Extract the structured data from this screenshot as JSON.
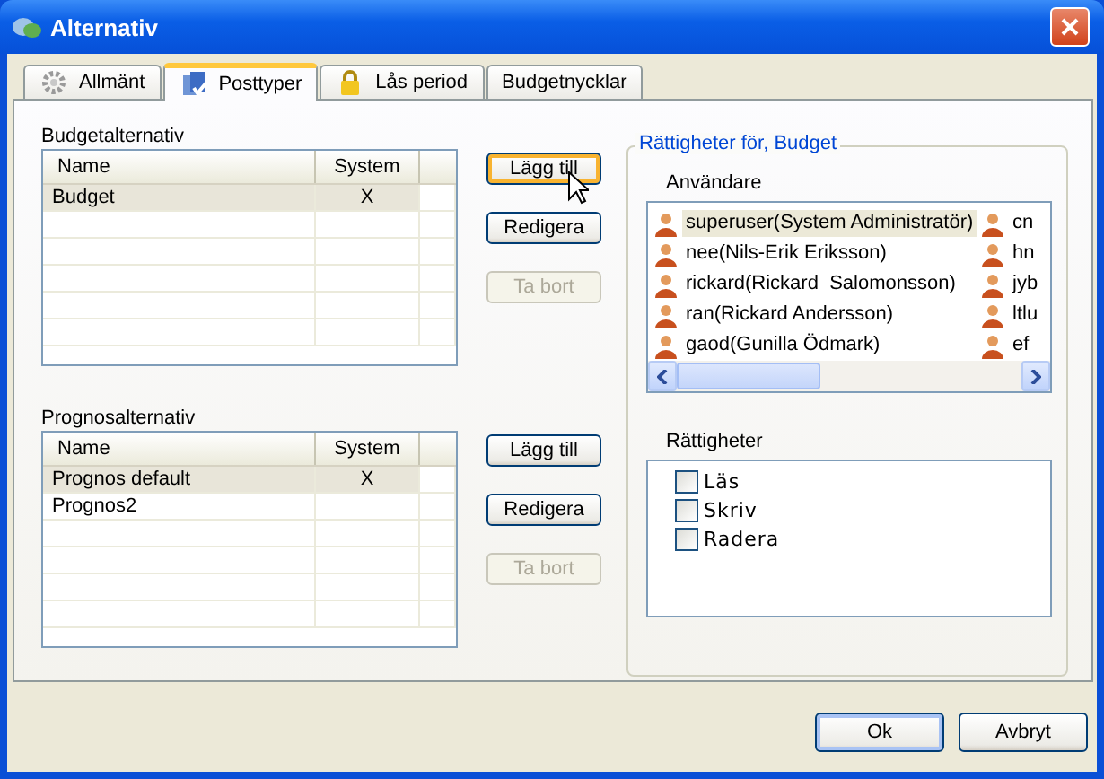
{
  "window": {
    "title": "Alternativ"
  },
  "tabs": [
    {
      "label": "Allmänt",
      "kind": "gear",
      "selected": false
    },
    {
      "label": "Posttyper",
      "kind": "types",
      "selected": true
    },
    {
      "label": "Lås period",
      "kind": "lock",
      "selected": false
    },
    {
      "label": "Budgetnycklar",
      "kind": "none",
      "selected": false
    }
  ],
  "lists": [
    {
      "label": "Budgetalternativ",
      "columns": [
        "Name",
        "System"
      ],
      "rows": [
        {
          "name": "Budget",
          "system": "X",
          "selected": true
        }
      ],
      "buttons": [
        {
          "label": "Lägg till",
          "disabled": false,
          "hovered": true
        },
        {
          "label": "Redigera",
          "disabled": false,
          "hovered": false
        },
        {
          "label": "Ta bort",
          "disabled": true,
          "hovered": false
        }
      ]
    },
    {
      "label": "Prognosalternativ",
      "columns": [
        "Name",
        "System"
      ],
      "rows": [
        {
          "name": "Prognos default",
          "system": "X",
          "selected": true
        },
        {
          "name": "Prognos2",
          "system": "",
          "selected": false
        }
      ],
      "buttons": [
        {
          "label": "Lägg till",
          "disabled": false,
          "hovered": false
        },
        {
          "label": "Redigera",
          "disabled": false,
          "hovered": false
        },
        {
          "label": "Ta bort",
          "disabled": true,
          "hovered": false
        }
      ]
    }
  ],
  "rights": {
    "title": "Rättigheter för, Budget",
    "users_label": "Användare",
    "users": [
      {
        "name": "superuser(System Administratör)",
        "selected": true
      },
      {
        "name": "nee(Nils-Erik Eriksson)",
        "selected": false
      },
      {
        "name": "rickard(Rickard  Salomonsson)",
        "selected": false
      },
      {
        "name": "ran(Rickard Andersson)",
        "selected": false
      },
      {
        "name": "gaod(Gunilla Ödmark)",
        "selected": false
      }
    ],
    "users_column_2": [
      {
        "name": "cn",
        "selected": false
      },
      {
        "name": "hn",
        "selected": false
      },
      {
        "name": "jyb",
        "selected": false
      },
      {
        "name": "ltlu",
        "selected": false
      },
      {
        "name": "ef",
        "selected": false
      }
    ],
    "permissions_label": "Rättigheter",
    "permissions": [
      {
        "label": "Läs",
        "checked": false
      },
      {
        "label": "Skriv",
        "checked": false
      },
      {
        "label": "Radera",
        "checked": false
      }
    ]
  },
  "buttons": [
    {
      "label": "Ok",
      "default": true
    },
    {
      "label": "Avbryt",
      "default": false
    }
  ]
}
